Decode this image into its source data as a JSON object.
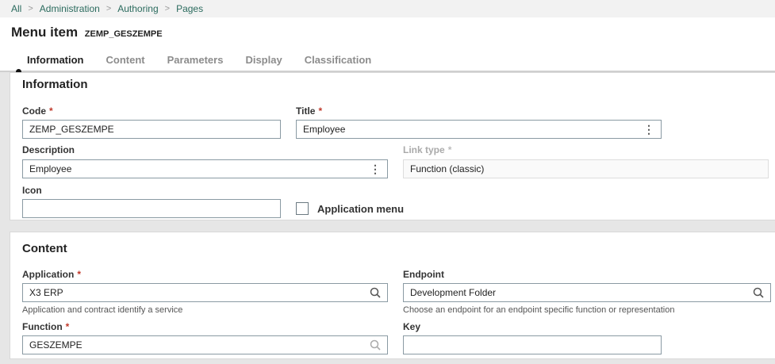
{
  "breadcrumb": {
    "items": [
      "All",
      "Administration",
      "Authoring",
      "Pages"
    ]
  },
  "header": {
    "title": "Menu item",
    "code": "ZEMP_GESZEMPE"
  },
  "tabs": [
    {
      "label": "Information",
      "active": true
    },
    {
      "label": "Content"
    },
    {
      "label": "Parameters"
    },
    {
      "label": "Display"
    },
    {
      "label": "Classification"
    }
  ],
  "information": {
    "title": "Information",
    "code": {
      "label": "Code",
      "value": "ZEMP_GESZEMPE"
    },
    "title_field": {
      "label": "Title",
      "value": "Employee"
    },
    "description": {
      "label": "Description",
      "value": "Employee"
    },
    "link_type": {
      "label": "Link type",
      "value": "Function (classic)"
    },
    "icon": {
      "label": "Icon",
      "value": ""
    },
    "application_menu": {
      "label": "Application menu",
      "checked": false
    }
  },
  "content": {
    "title": "Content",
    "application": {
      "label": "Application",
      "value": "X3 ERP",
      "hint": "Application and contract identify a service"
    },
    "endpoint": {
      "label": "Endpoint",
      "value": "Development Folder",
      "hint": "Choose an endpoint for an endpoint specific function or representation"
    },
    "function": {
      "label": "Function",
      "value": "GESZEMPE"
    },
    "key": {
      "label": "Key",
      "value": ""
    }
  },
  "colors": {
    "breadcrumb_link": "#2b6b5e",
    "required_star": "#c0392b",
    "field_border": "#8a9aa3"
  },
  "icons": {
    "required": "*",
    "kebab": "⋮",
    "separator": ">",
    "search": "search-icon"
  }
}
